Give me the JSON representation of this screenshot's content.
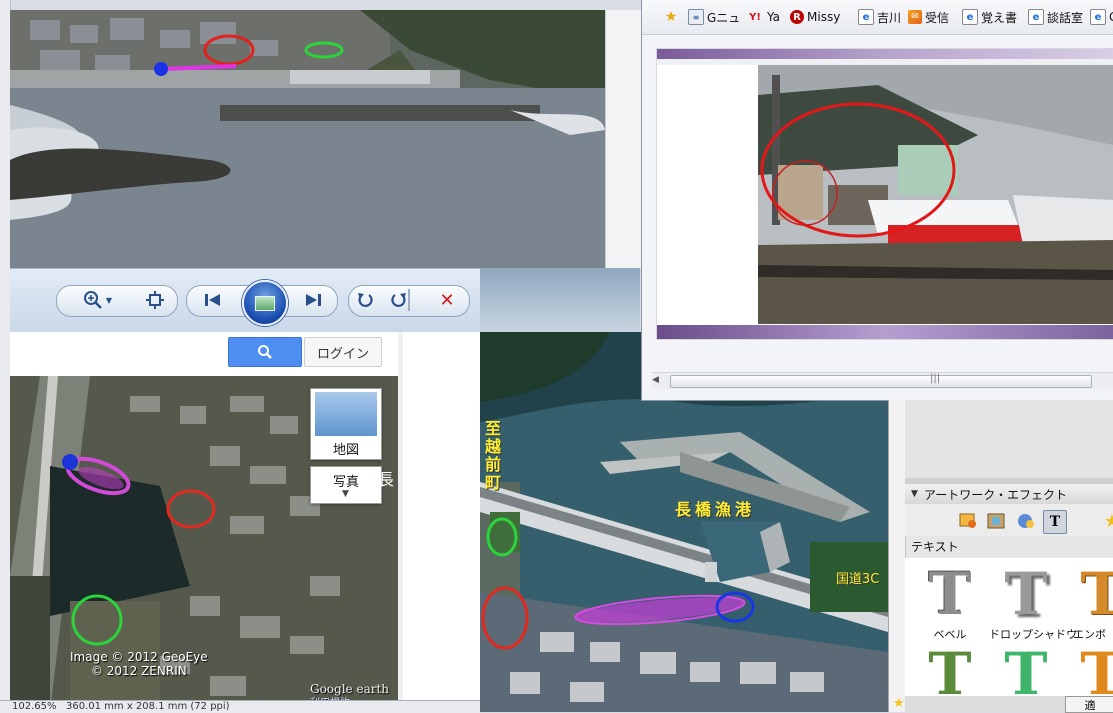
{
  "photo_viewer": {
    "toolbar": {
      "zoom_icon": "magnifier-plus-icon",
      "fit_icon": "fit-window-icon",
      "prev_icon": "previous-icon",
      "slideshow_icon": "slideshow-icon",
      "next_icon": "next-icon",
      "rotate_ccw_icon": "rotate-counterclockwise-icon",
      "rotate_cw_icon": "rotate-clockwise-icon",
      "delete_icon": "delete-icon"
    }
  },
  "browser": {
    "favorites": [
      {
        "label": "Gニュ",
        "icon": "news-icon"
      },
      {
        "label": "Ya",
        "icon": "yahoo-icon",
        "icon_text": "Y!"
      },
      {
        "label": "Missy",
        "icon": "r-logo-icon",
        "icon_text": "R"
      },
      {
        "label": "吉川",
        "icon": "ie-page-icon"
      },
      {
        "label": "受信",
        "icon": "mail-icon"
      },
      {
        "label": "覚え書",
        "icon": "ie-page-icon"
      },
      {
        "label": "談話室",
        "icon": "ie-page-icon"
      },
      {
        "label": "G",
        "icon": "ie-page-icon"
      }
    ],
    "scroll_grip": "|||"
  },
  "google_maps": {
    "search_button_icon": "search-icon",
    "login_label": "ログイン",
    "map_type_map": "地図",
    "map_type_photo": "写真",
    "side_char": "長",
    "copyright_line1": "Image © 2012 GeoEye",
    "copyright_line2": "© 2012 ZENRIN",
    "logo": "Google earth",
    "terms": "利用規約"
  },
  "aerial_photo": {
    "label_direction": "至越前町",
    "label_harbor": "長橋漁港",
    "label_road": "国道3C"
  },
  "ps_panel": {
    "header": "アートワーク・エフェクト",
    "section_label": "テキスト",
    "tiles": [
      {
        "label": "ベベル",
        "color": "#8d8d8d"
      },
      {
        "label": "ドロップシャドウ",
        "color": "#9a9a9a"
      },
      {
        "label": "エンボ",
        "color": "#d48a2a"
      },
      {
        "label": "",
        "color": "#5a8a3a"
      },
      {
        "label": "",
        "color": "#3fb56b"
      },
      {
        "label": "",
        "color": "#e08a1e"
      }
    ],
    "apply_label": "適"
  },
  "statusbar": {
    "zoom": "102.65%",
    "size": "360.01 mm x 208.1 mm (72 ppi)"
  }
}
